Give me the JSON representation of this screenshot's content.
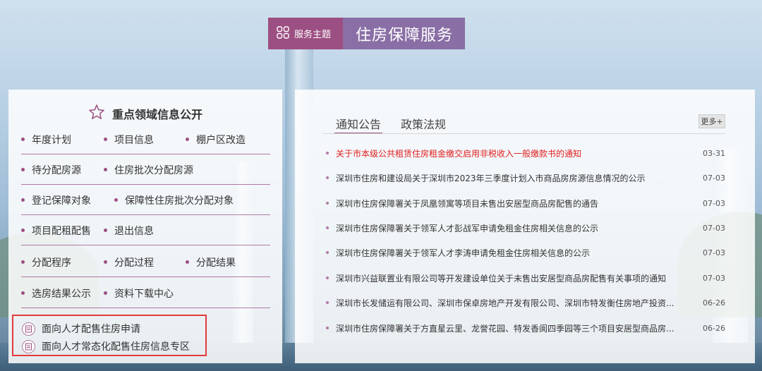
{
  "theme": {
    "tag_label": "服务主题",
    "title": "住房保障服务"
  },
  "left": {
    "heading": "重点领域信息公开",
    "rows": [
      [
        "年度计划",
        "项目信息",
        "棚户区改造"
      ],
      [
        "待分配房源",
        "住房批次分配房源"
      ],
      [
        "登记保障对象",
        "保障性住房批次分配对象"
      ],
      [
        "项目配租配售",
        "退出信息"
      ],
      [
        "分配程序",
        "分配过程",
        "分配结果"
      ],
      [
        "选房结果公示",
        "资料下载中心"
      ]
    ],
    "special": [
      "面向人才配售住房申请",
      "面向人才常态化配售住房信息专区"
    ]
  },
  "right": {
    "tabs": [
      "通知公告",
      "政策法规"
    ],
    "more_label": "更多+",
    "news": [
      {
        "title": "关于市本级公共租赁住房租金缴交启用非税收入一般缴款书的通知",
        "date": "03-31",
        "hot": true
      },
      {
        "title": "深圳市住房和建设局关于深圳市2023年三季度计划入市商品房房源信息情况的公示",
        "date": "07-03",
        "hot": false
      },
      {
        "title": "深圳市住房保障署关于凤凰领寓等项目未售出安居型商品房配售的通告",
        "date": "07-03",
        "hot": false
      },
      {
        "title": "深圳市住房保障署关于领军人才彭战军申请免租金住房相关信息的公示",
        "date": "07-03",
        "hot": false
      },
      {
        "title": "深圳市住房保障署关于领军人才李涛申请免租金住房相关信息的公示",
        "date": "07-03",
        "hot": false
      },
      {
        "title": "深圳市兴益联置业有限公司等开发建设单位关于未售出安居型商品房配售有关事项的通知",
        "date": "07-03",
        "hot": false
      },
      {
        "title": "深圳市长发储运有限公司、深圳市保卓房地产开发有限公司、深圳市特发衡住房地产投资...",
        "date": "06-26",
        "hot": false
      },
      {
        "title": "深圳市住房保障署关于方直星云里、龙誉花园、特发香阆四季园等三个项目安居型商品房...",
        "date": "06-26",
        "hot": false
      }
    ]
  }
}
